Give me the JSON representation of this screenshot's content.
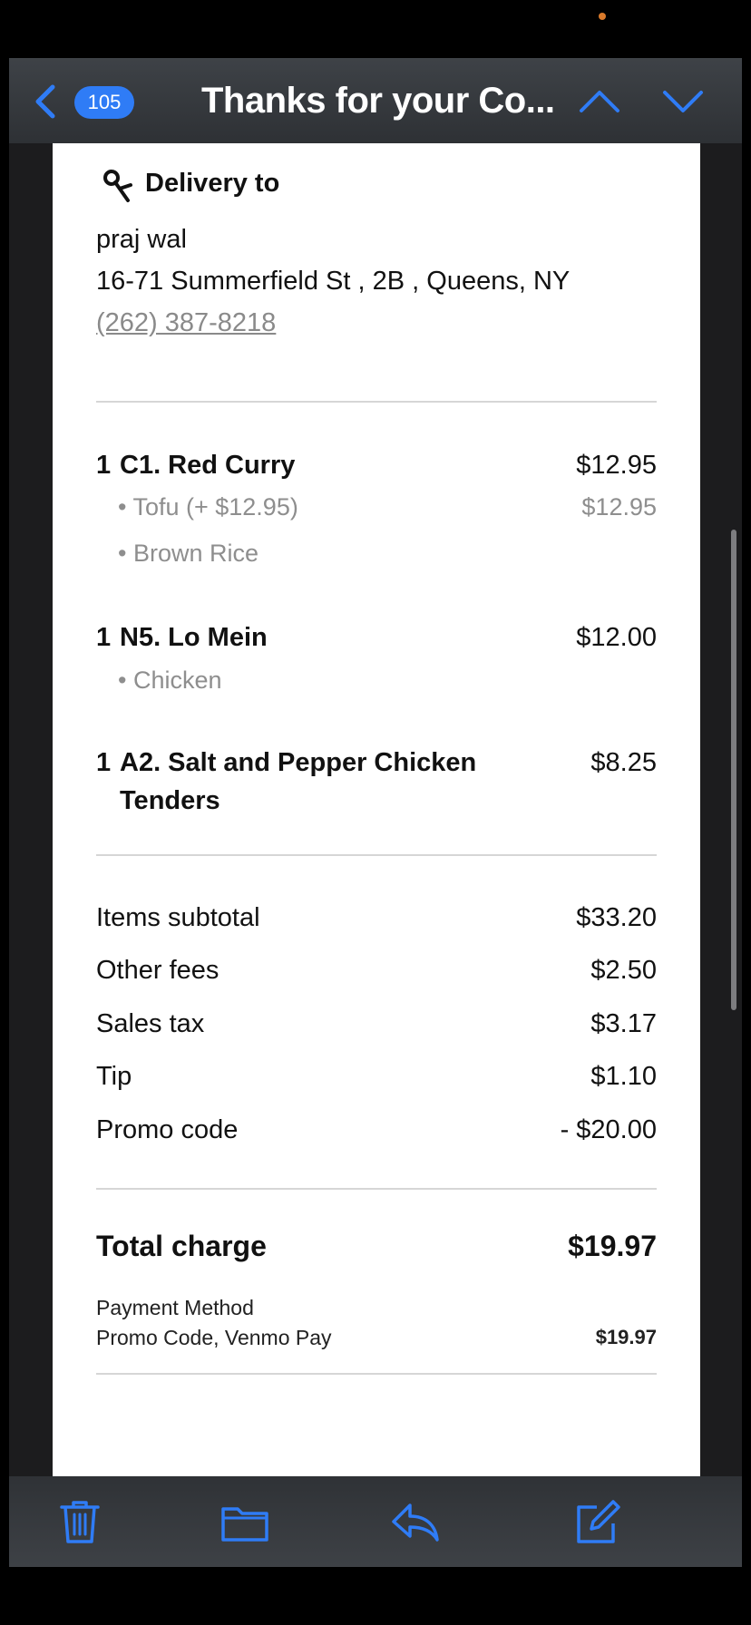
{
  "nav": {
    "unread_count": "105",
    "title": "Thanks for your Co..."
  },
  "delivery": {
    "label": "Delivery to",
    "name": "praj wal",
    "address": "16-71 Summerfield St , 2B , Queens, NY",
    "phone": "(262) 387-8218"
  },
  "items": [
    {
      "qty": "1",
      "name": "C1. Red Curry",
      "price": "$12.95",
      "modifiers": [
        {
          "text": "• Tofu (+ $12.95)",
          "price": "$12.95"
        },
        {
          "text": "• Brown Rice",
          "price": ""
        }
      ]
    },
    {
      "qty": "1",
      "name": "N5. Lo Mein",
      "price": "$12.00",
      "modifiers": [
        {
          "text": "• Chicken",
          "price": ""
        }
      ]
    },
    {
      "qty": "1",
      "name": "A2. Salt and Pepper Chicken Tenders",
      "price": "$8.25",
      "modifiers": []
    }
  ],
  "summary": [
    {
      "label": "Items subtotal",
      "value": "$33.20"
    },
    {
      "label": "Other fees",
      "value": "$2.50"
    },
    {
      "label": "Sales tax",
      "value": "$3.17"
    },
    {
      "label": "Tip",
      "value": "$1.10"
    },
    {
      "label": "Promo code",
      "value": "- $20.00"
    }
  ],
  "total": {
    "label": "Total charge",
    "value": "$19.97"
  },
  "payment": {
    "heading": "Payment Method",
    "method": "Promo Code, Venmo Pay",
    "amount": "$19.97"
  },
  "colors": {
    "accent": "#2f7cf6",
    "muted_text": "#8e8e8e"
  },
  "icons": {
    "back": "chevron-left-icon",
    "previous": "chevron-up-icon",
    "next": "chevron-down-icon",
    "delivery": "delivery-icon",
    "trash": "trash-icon",
    "folder": "folder-icon",
    "reply": "reply-icon",
    "compose": "compose-icon"
  }
}
